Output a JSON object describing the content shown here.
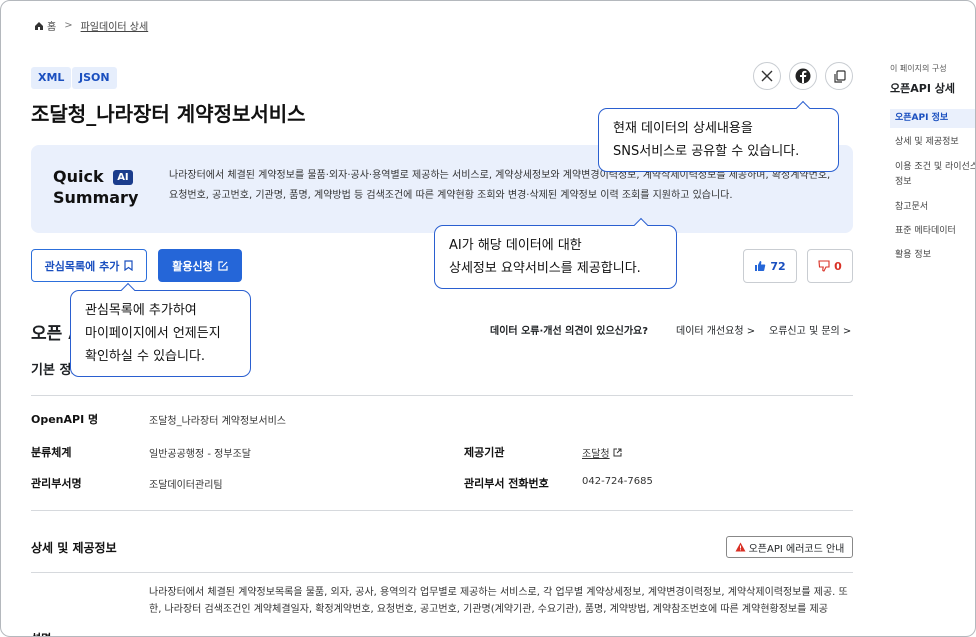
{
  "breadcrumb": {
    "home": "홈",
    "separator": ">",
    "current": "파일데이터 상세"
  },
  "tags": [
    "XML",
    "JSON"
  ],
  "title": "조달청_나라장터 계약정보서비스",
  "share_icons": [
    "x-icon",
    "facebook-icon",
    "copy-icon"
  ],
  "quick_summary": {
    "title_line1": "Quick",
    "ai_badge": "AI",
    "title_line2": "Summary",
    "text": "나라장터에서 체결된 계약정보를 물품·외자·공사·용역별로 제공하는 서비스로, 계약상세정보와 계약변경이력정보, 계약삭제이력정보를 제공하며, 확정계약번호, 요청번호, 공고번호, 기관명, 품명, 계약방법 등 검색조건에 따른 계약현황 조회와 변경·삭제된 계약정보 이력 조회를 지원하고 있습니다."
  },
  "actions": {
    "add_favorite": "관심목록에 추가",
    "apply": "활용신청"
  },
  "votes": {
    "likes": "72",
    "dislikes": "0"
  },
  "section_title": "오픈 API 정보",
  "basic_info_title": "기본 정보",
  "feedback": {
    "question": "데이터 오류·개선 의견이 있으신가요?",
    "improve": "데이터 개선요청 >",
    "report": "오류신고 및 문의 >"
  },
  "info": {
    "openapi_label": "OpenAPI 명",
    "openapi_value": "조달청_나라장터 계약정보서비스",
    "category_label": "분류체계",
    "category_value": "일반공공행정 - 정부조달",
    "provider_label": "제공기관",
    "provider_value": "조달청",
    "dept_label": "관리부서명",
    "dept_value": "조달데이터관리팀",
    "phone_label": "관리부서 전화번호",
    "phone_value": "042-724-7685"
  },
  "detail": {
    "title": "상세 및 제공정보",
    "error_button": "오픈API 에러코드 안내",
    "desc_label": "설명",
    "description": "나라장터에서 체결된 계약정보목록을 물품, 외자, 공사, 용역의각 업무별로 제공하는 서비스로, 각 업무별 계약상세정보, 계약변경이력정보, 계약삭제이력정보를 제공. 또한, 나라장터 검색조건인 계약체결일자, 확정계약번호, 요청번호, 공고번호, 기관명(계약기관, 수요기관), 품명, 계약방법, 계약참조번호에 따른 계약현황정보를 제공"
  },
  "toc": {
    "caption": "이 페이지의 구성",
    "title": "오픈API 상세",
    "items": [
      "오픈API 정보",
      "상세 및 제공정보",
      "이용 조건 및 라이선스 정보",
      "참고문서",
      "표준 메타데이터",
      "활용 정보"
    ]
  },
  "tooltips": {
    "share": [
      "현재 데이터의 상세내용을",
      "SNS서비스로 공유할 수 있습니다."
    ],
    "ai": [
      "AI가 해당 데이터에 대한",
      "상세정보 요약서비스를 제공합니다."
    ],
    "favorite": [
      "관심목록에 추가하여",
      "마이페이지에서 언제든지",
      "확인하실 수 있습니다."
    ]
  },
  "colors": {
    "accent": "#2566d8",
    "summary_bg": "#eaf0fc",
    "tooltip_border": "#2a5fd0",
    "error_icon": "#d93025",
    "dislike": "#d93025"
  }
}
